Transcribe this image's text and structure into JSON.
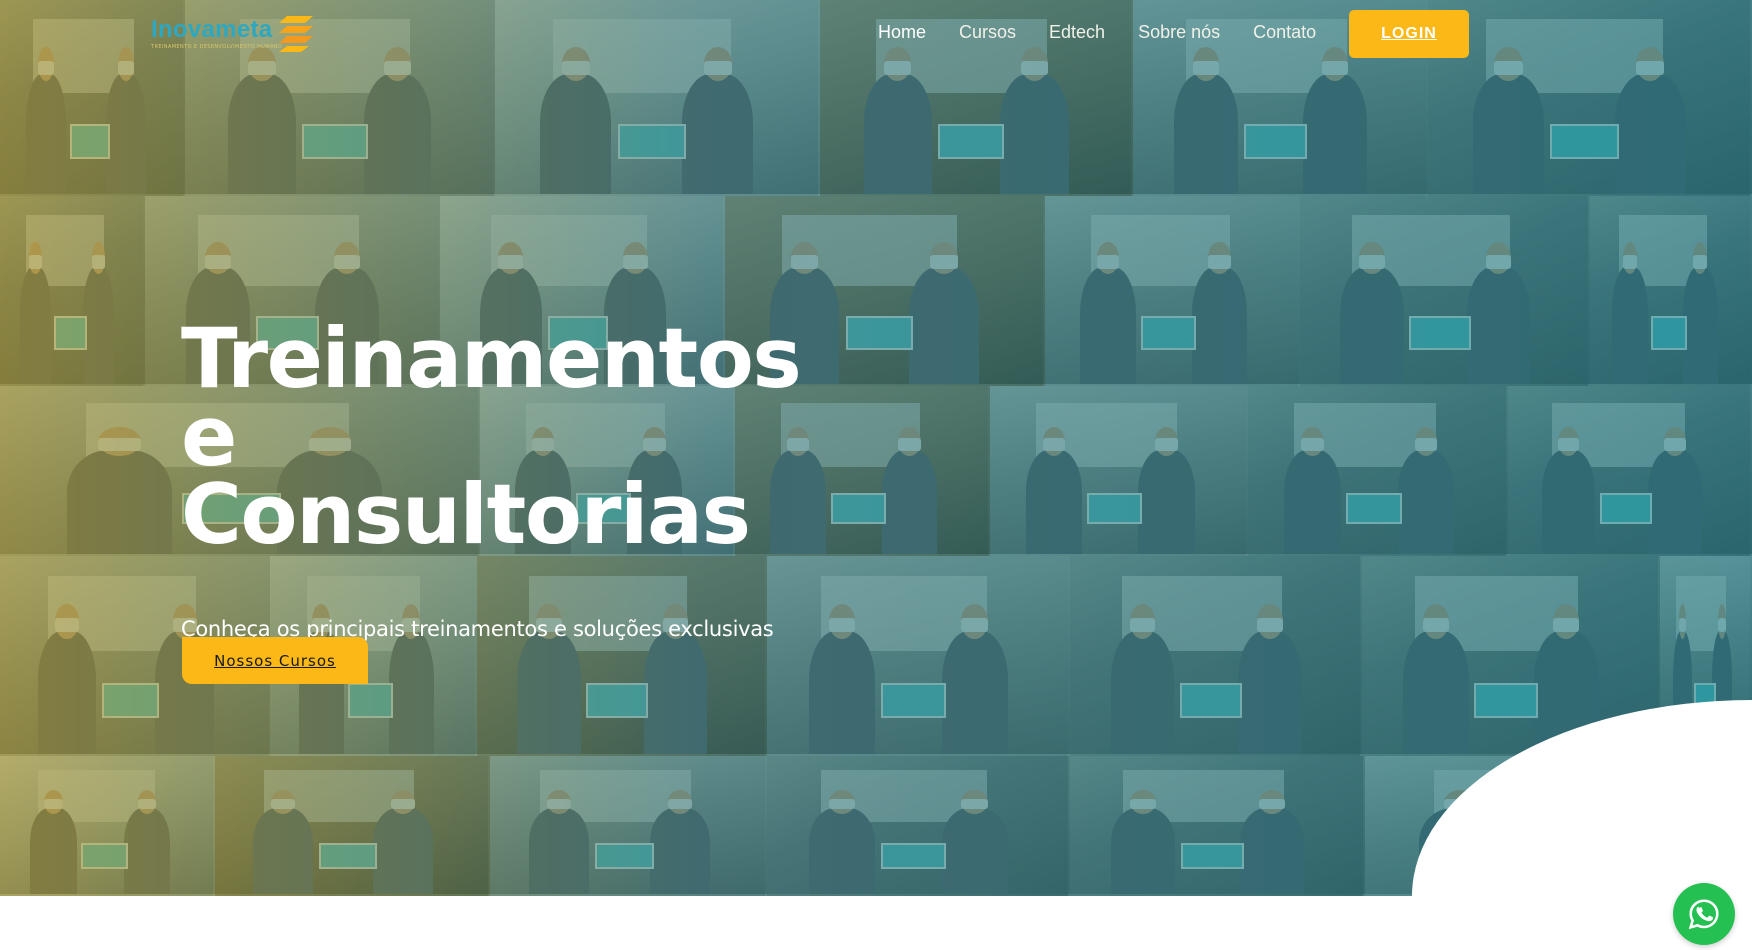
{
  "brand": {
    "name": "Inovameta",
    "tagline": "TREINAMENTO E DESENVOLVIMENTO HUMANO",
    "primary_color": "#2ea8c0",
    "accent_color": "#fbb816"
  },
  "nav": {
    "items": [
      {
        "label": "Home",
        "active": true
      },
      {
        "label": "Cursos",
        "active": false
      },
      {
        "label": "Edtech",
        "active": false
      },
      {
        "label": "Sobre nós",
        "active": false
      },
      {
        "label": "Contato",
        "active": false
      }
    ],
    "login_label": "LOGIN"
  },
  "hero": {
    "title": "Treinamentos e Consultorias",
    "subtitle": "Conheça os principais treinamentos e soluções exclusivas da Inovameta.",
    "cta_label": "Nossos Cursos",
    "background": "grid of group photos of trainees holding certificates"
  },
  "floating": {
    "whatsapp_icon": "whatsapp-icon",
    "whatsapp_color": "#25c052"
  }
}
